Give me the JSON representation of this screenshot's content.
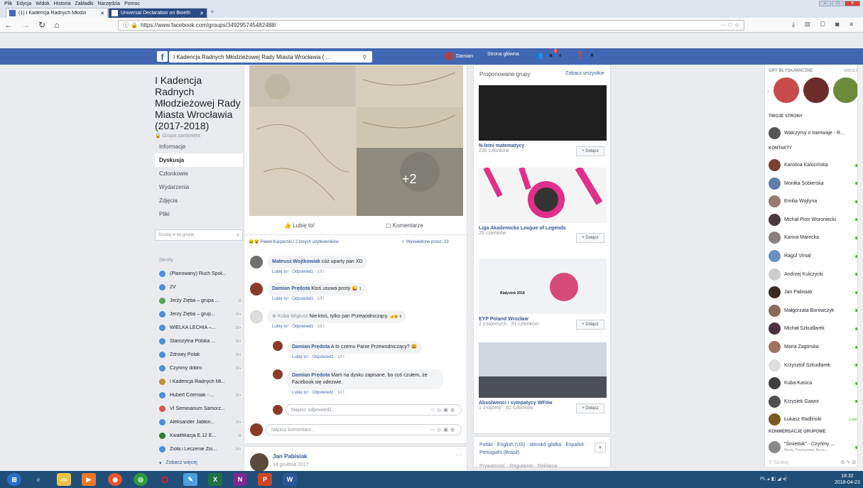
{
  "browser": {
    "menu": [
      "Plik",
      "Edycja",
      "Widok",
      "Historia",
      "Zakładki",
      "Narzędzia",
      "Pomoc"
    ],
    "tabs": [
      {
        "label": "(1) I Kadencja Radnych Młodzi"
      },
      {
        "label": "Universal Declaration on Bioeth"
      }
    ],
    "url": "https://www.facebook.com/groups/349295745482488/"
  },
  "fb_header": {
    "search_value": "I Kadencja Radnych Młodzieżowej Rady Miasta Wrocławia ( ...",
    "user": "Damian",
    "home": "Strona główna",
    "notif_count": "3"
  },
  "group": {
    "title": "I Kadencja Radnych Młodzieżowej Rady Miasta Wrocławia (2017-2018)",
    "privacy": "Grupa zamknięta",
    "nav": [
      "Informacje",
      "Dyskusja",
      "Członkowie",
      "Wydarzenia",
      "Zdjęcia",
      "Pliki"
    ],
    "active_nav": "Dyskusja",
    "search_placeholder": "Szukaj w tej grupie"
  },
  "shortcuts": {
    "label": "Skróty",
    "items": [
      {
        "name": "(Planowany) Ruch Społ...",
        "count": ""
      },
      {
        "name": "2V",
        "count": ""
      },
      {
        "name": "Jerzy Zięba – grupa ...",
        "count": "16"
      },
      {
        "name": "Jerzy Zięba – grup...",
        "count": "20+"
      },
      {
        "name": "WIELKA LECHIA –...",
        "count": "20+"
      },
      {
        "name": "Starożytna Polska ...",
        "count": "20+"
      },
      {
        "name": "Zdrowy Polak",
        "count": "20+"
      },
      {
        "name": "Czyńmy dobro",
        "count": "20+"
      },
      {
        "name": "I Kadencja Radnych Mł...",
        "count": ""
      },
      {
        "name": "Hubert Czerniak - ...",
        "count": "20+"
      },
      {
        "name": "VI Seminarium Samorz...",
        "count": ""
      },
      {
        "name": "Aleksander Jabłon...",
        "count": "20+"
      },
      {
        "name": "Kwalifikacja E.12 E...",
        "count": "15"
      },
      {
        "name": "Zioła i Leczenie Zio...",
        "count": "20+"
      }
    ],
    "more": "Zobacz więcej"
  },
  "post": {
    "plus_photos": "+2",
    "like": "Lubię to!",
    "comment": "Komentarze",
    "reactions_text": "Paweł Kacperski i 2 innych użytkowników",
    "seen": "Wyświetlone przez: 33",
    "comments": [
      {
        "author": "Mateusz Wojtkowiak",
        "text": "cóż uparty pan XD",
        "like": "Lubię to!",
        "reply": "Odpowiedz",
        "time": "18 t"
      },
      {
        "author": "Damian Prędota",
        "text": "Ktoś usuwa posty",
        "like": "Lubię to!",
        "reply": "Odpowiedz",
        "time": "18 t",
        "reactions": "1"
      },
      {
        "author": "Kuba Wiglusz",
        "text": "Nie ktoś, tylko pan Przewodniczący.",
        "like": "Lubię to!",
        "reply": "Odpowiedz",
        "time": "18 t",
        "reactions": "6"
      }
    ],
    "replies": [
      {
        "author": "Damian Prędota",
        "text": "A to czemu Panie Przewodniczący?",
        "like": "Lubię to!",
        "reply": "Odpowiedz",
        "time": "18 t"
      },
      {
        "author": "Damian Prędota",
        "text": "Mam na dysku zapisane, bo coś czułem, że Facebook się odezwie.",
        "like": "Lubię to!",
        "reply": "Odpowiedz",
        "time": "18 t"
      }
    ],
    "reply_placeholder": "Napisz odpowiedź...",
    "comment_placeholder": "Napisz komentarz..."
  },
  "post2": {
    "author": "Jan Pabisiak",
    "date": "14 grudnia 2017"
  },
  "suggested": {
    "title": "Proponowane grupy",
    "see_all": "Zobacz wszystkie",
    "join": "+ Dołącz",
    "groups": [
      {
        "name": "N-letni matematycy",
        "meta": "236 członków"
      },
      {
        "name": "Liga Akademicka League of Legends",
        "meta": "25 członków"
      },
      {
        "name": "EYP Poland Wrocław",
        "meta": "2 znajomych · 91 członków"
      },
      {
        "name": "Absolwenci i sympatycy WFów",
        "meta": "1 znajomy · 82 członków"
      }
    ],
    "collage_label": "Białystok 2018"
  },
  "footer": {
    "text": "Polski · English (US) · ślōnskŏ gŏdka · Español · Português (Brasil)",
    "plus": "+",
    "more": "Prywatność · Regulamin · Reklama"
  },
  "chat": {
    "games_label": "GRY BŁYSKAWICZNE",
    "more_label": "WIĘCEJ",
    "pages_label": "TWOJE STRONY",
    "page_name": "Walczymy o tramwaje - R...",
    "contacts_label": "KONTAKTY",
    "contacts": [
      {
        "name": "Karolina Kalocińska",
        "status": "online"
      },
      {
        "name": "Monika Sobierska",
        "status": "online"
      },
      {
        "name": "Emilia Wojtyna",
        "status": "online"
      },
      {
        "name": "Michał Piotr Woroniecki",
        "status": "online"
      },
      {
        "name": "Karina Marecka",
        "status": "online"
      },
      {
        "name": "Ragul Vimal",
        "status": "online"
      },
      {
        "name": "Andrzej Kulczycki",
        "status": "online"
      },
      {
        "name": "Jan Pabisiak",
        "status": "online"
      },
      {
        "name": "Małgorzata Borowczyk",
        "status": "online"
      },
      {
        "name": "Michał Szkudlarek",
        "status": "online"
      },
      {
        "name": "Maria Zagórska",
        "status": "online"
      },
      {
        "name": "Krzysztof Szkudlarek",
        "status": "online"
      },
      {
        "name": "Kuba Kasica",
        "status": "online"
      },
      {
        "name": "Krzysiek Gawor",
        "status": "online"
      },
      {
        "name": "Łukasz Radliński",
        "status": "2 godz."
      }
    ],
    "group_chats_label": "KONWERSACJE GRUPOWE",
    "group_chat": "\"Śmietnik\" - Czyńmy ...",
    "group_chat_members": "Maria, Przemysław, Rena...",
    "search": "Szukaj"
  },
  "taskbar": {
    "clock": "18:32",
    "date": "2018-04-23"
  },
  "colors": {
    "fb_blue": "#4267b2",
    "link": "#385898",
    "bg": "#e9ebee"
  }
}
